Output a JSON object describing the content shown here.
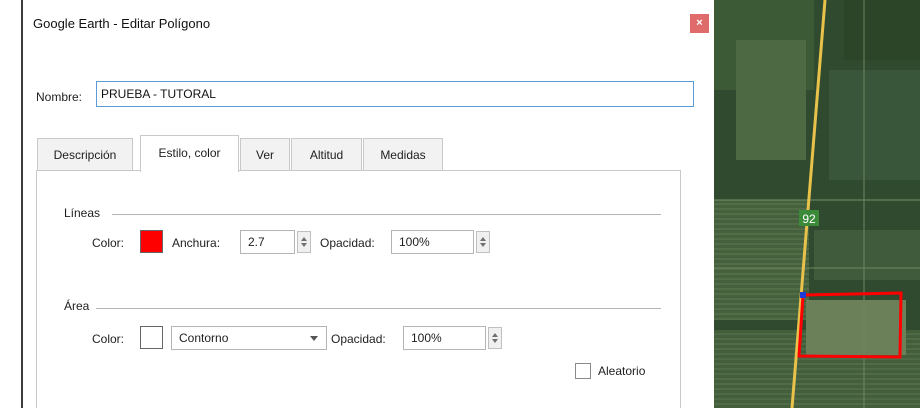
{
  "window": {
    "title": "Google Earth - Editar Polígono",
    "close_glyph": "×"
  },
  "name_field": {
    "label": "Nombre:",
    "value": "PRUEBA - TUTORAL"
  },
  "tabs": [
    {
      "label": "Descripción",
      "active": false
    },
    {
      "label": "Estilo, color",
      "active": true
    },
    {
      "label": "Ver",
      "active": false
    },
    {
      "label": "Altitud",
      "active": false
    },
    {
      "label": "Medidas",
      "active": false
    }
  ],
  "lines": {
    "section_title": "Líneas",
    "color_label": "Color:",
    "color_value": "#ff0000",
    "width_label": "Anchura:",
    "width_value": "2.7",
    "opacity_label": "Opacidad:",
    "opacity_value": "100%"
  },
  "area": {
    "section_title": "Área",
    "color_label": "Color:",
    "color_value": "#ffffff",
    "fill_mode": "Contorno",
    "opacity_label": "Opacidad:",
    "opacity_value": "100%",
    "random_label": "Aleatorio",
    "random_checked": false
  },
  "map": {
    "road_number": "92",
    "polygon_color": "#ff0000",
    "road_color": "#e8c24a",
    "vertex_color": "#1f3bd6"
  }
}
